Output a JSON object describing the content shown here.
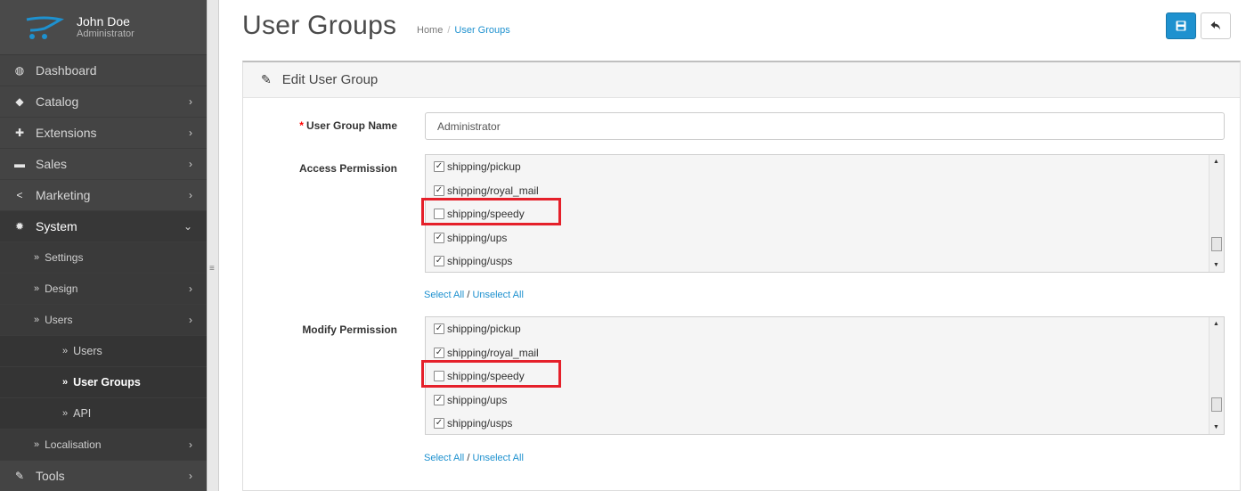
{
  "profile": {
    "name": "John Doe",
    "role": "Administrator"
  },
  "nav": [
    {
      "label": "Dashboard",
      "icon": "dashboard-icon",
      "glyph": "◍",
      "chevron": ""
    },
    {
      "label": "Catalog",
      "icon": "tag-icon",
      "glyph": "◆",
      "chevron": "›"
    },
    {
      "label": "Extensions",
      "icon": "puzzle-icon",
      "glyph": "✚",
      "chevron": "›"
    },
    {
      "label": "Sales",
      "icon": "cart-icon",
      "glyph": "▬",
      "chevron": "›"
    },
    {
      "label": "Marketing",
      "icon": "share-icon",
      "glyph": "<",
      "chevron": "›"
    },
    {
      "label": "System",
      "icon": "cog-icon",
      "glyph": "✹",
      "chevron": "⌄"
    }
  ],
  "system_sub": [
    {
      "label": "Settings",
      "chevron": ""
    },
    {
      "label": "Design",
      "chevron": "›"
    },
    {
      "label": "Users",
      "chevron": "›"
    }
  ],
  "users_sub": [
    {
      "label": "Users"
    },
    {
      "label": "User Groups"
    },
    {
      "label": "API"
    }
  ],
  "localisation": {
    "label": "Localisation",
    "chevron": "›"
  },
  "tools": {
    "label": "Tools",
    "chevron": "›"
  },
  "header": {
    "title": "User Groups",
    "breadcrumb_home": "Home",
    "breadcrumb_sep": "/",
    "breadcrumb_current": "User Groups"
  },
  "panel": {
    "title": "Edit User Group"
  },
  "form": {
    "name_label": "User Group Name",
    "required_mark": "*",
    "name_value": "Administrator",
    "access_label": "Access Permission",
    "modify_label": "Modify Permission",
    "select_all": "Select All",
    "slash": "/",
    "unselect_all": "Unselect All"
  },
  "access_permissions": [
    {
      "label": "shipping/pickup",
      "checked": true
    },
    {
      "label": "shipping/royal_mail",
      "checked": true
    },
    {
      "label": "shipping/speedy",
      "checked": false
    },
    {
      "label": "shipping/ups",
      "checked": true
    },
    {
      "label": "shipping/usps",
      "checked": true
    }
  ],
  "modify_permissions": [
    {
      "label": "shipping/pickup",
      "checked": true
    },
    {
      "label": "shipping/royal_mail",
      "checked": true
    },
    {
      "label": "shipping/speedy",
      "checked": false
    },
    {
      "label": "shipping/ups",
      "checked": true
    },
    {
      "label": "shipping/usps",
      "checked": true
    }
  ],
  "colors": {
    "accent": "#1e91cf",
    "highlight": "#e5202a",
    "sidebar": "#444444"
  }
}
